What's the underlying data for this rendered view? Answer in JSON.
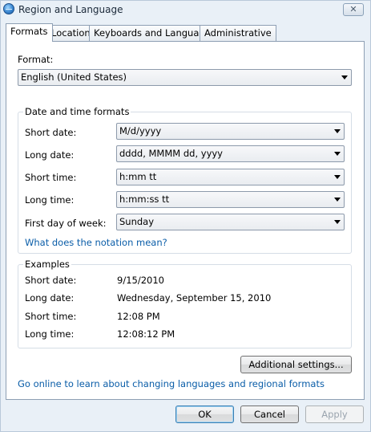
{
  "window": {
    "title": "Region and Language",
    "close_glyph": "✕",
    "title_icon": "globe-icon",
    "close_icon": "close-icon"
  },
  "tabs": [
    {
      "label": "Formats",
      "active": true
    },
    {
      "label": "Location",
      "active": false
    },
    {
      "label": "Keyboards and Languages",
      "active": false
    },
    {
      "label": "Administrative",
      "active": false
    }
  ],
  "format": {
    "label": "Format:",
    "value": "English (United States)"
  },
  "date_time": {
    "group_title": "Date and time formats",
    "short_date": {
      "label": "Short date:",
      "value": "M/d/yyyy"
    },
    "long_date": {
      "label": "Long date:",
      "value": "dddd, MMMM dd, yyyy"
    },
    "short_time": {
      "label": "Short time:",
      "value": "h:mm tt"
    },
    "long_time": {
      "label": "Long time:",
      "value": "h:mm:ss tt"
    },
    "first_day": {
      "label": "First day of week:",
      "value": "Sunday"
    },
    "notation_link": "What does the notation mean?"
  },
  "examples": {
    "group_title": "Examples",
    "short_date": {
      "label": "Short date:",
      "value": "9/15/2010"
    },
    "long_date": {
      "label": "Long date:",
      "value": "Wednesday, September 15, 2010"
    },
    "short_time": {
      "label": "Short time:",
      "value": "12:08 PM"
    },
    "long_time": {
      "label": "Long time:",
      "value": "12:08:12 PM"
    }
  },
  "additional_settings_label": "Additional settings...",
  "online_link": "Go online to learn about changing languages and regional formats",
  "buttons": {
    "ok": "OK",
    "cancel": "Cancel",
    "apply": "Apply"
  }
}
